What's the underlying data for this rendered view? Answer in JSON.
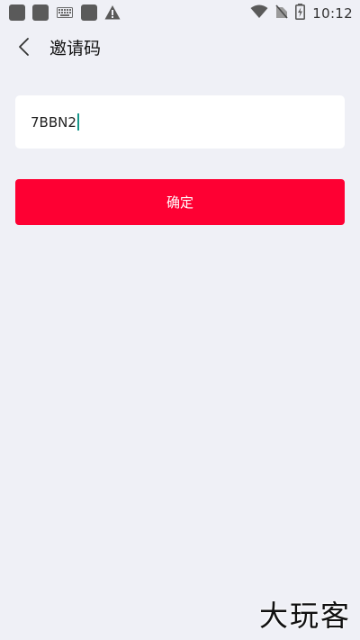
{
  "status_bar": {
    "time": "10:12",
    "icons": [
      "notification-icon",
      "notification-icon",
      "keyboard-icon",
      "notification-icon",
      "warning-icon",
      "wifi-icon",
      "no-signal-icon",
      "battery-charging-icon"
    ]
  },
  "header": {
    "back_icon": "chevron-left-icon",
    "title": "邀请码"
  },
  "invite": {
    "value": "7BBN2"
  },
  "confirm": {
    "label": "确定"
  },
  "watermark": {
    "text": "大玩客"
  },
  "colors": {
    "background": "#eff0f6",
    "accent": "#fe0033",
    "caret": "#16968a"
  }
}
